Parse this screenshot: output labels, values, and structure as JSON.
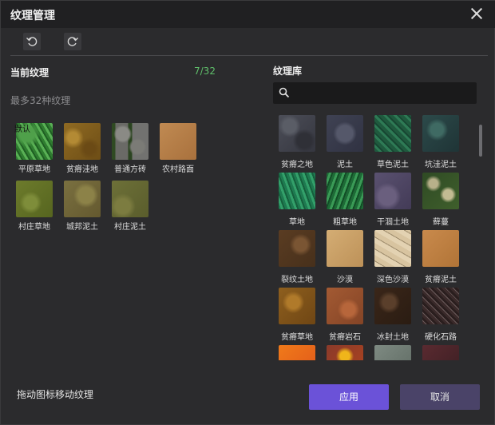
{
  "window": {
    "title": "纹理管理"
  },
  "current": {
    "title": "当前纹理",
    "count": "7/32",
    "hint": "最多32种纹理",
    "default_tag": "默认",
    "tiles": [
      {
        "label": "平原草地"
      },
      {
        "label": "贫瘠洼地"
      },
      {
        "label": "普通方砖"
      },
      {
        "label": "农村路面"
      },
      {
        "label": "村庄草地"
      },
      {
        "label": "城邦泥土"
      },
      {
        "label": "村庄泥土"
      }
    ]
  },
  "library": {
    "title": "纹理库",
    "search_placeholder": "",
    "tiles": [
      {
        "label": "贫瘠之地"
      },
      {
        "label": "泥土"
      },
      {
        "label": "草色泥土"
      },
      {
        "label": "坑洼泥土"
      },
      {
        "label": "草地"
      },
      {
        "label": "粗草地"
      },
      {
        "label": "干涸土地"
      },
      {
        "label": "藓蔓"
      },
      {
        "label": "裂纹土地"
      },
      {
        "label": "沙漠"
      },
      {
        "label": "深色沙漠"
      },
      {
        "label": "贫瘠泥土"
      },
      {
        "label": "贫瘠草地"
      },
      {
        "label": "贫瘠岩石"
      },
      {
        "label": "冰封土地"
      },
      {
        "label": "硬化石路"
      },
      {
        "label": ""
      },
      {
        "label": ""
      },
      {
        "label": ""
      },
      {
        "label": ""
      }
    ]
  },
  "footer": {
    "hint": "拖动图标移动纹理",
    "apply_label": "应用",
    "cancel_label": "取消"
  },
  "colors": {
    "accent": "#6b52d8",
    "count_green": "#5fbf6a",
    "cancel_bg": "#4a4368"
  }
}
